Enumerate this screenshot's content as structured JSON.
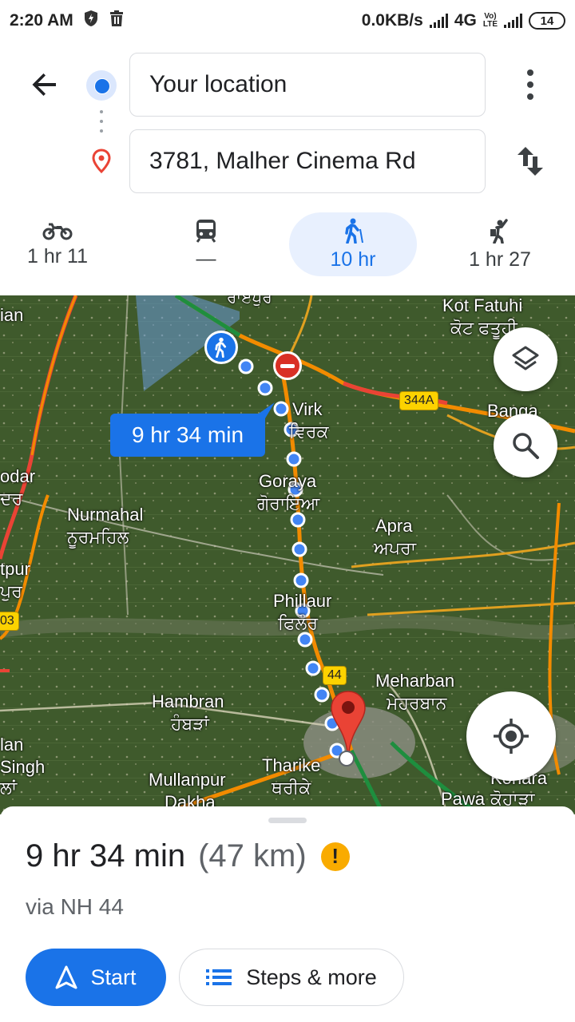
{
  "status_bar": {
    "time": "2:20 AM",
    "network_speed": "0.0KB/s",
    "network_type": "4G",
    "volte_line1": "Vo)",
    "volte_line2": "LTE",
    "battery": "14"
  },
  "directions": {
    "origin_value": "Your location",
    "destination_value": "3781, Malher Cinema Rd"
  },
  "travel_modes": [
    {
      "icon": "motorcycle-icon",
      "value": "1 hr 11",
      "selected": false
    },
    {
      "icon": "transit-icon",
      "value": "—",
      "selected": false
    },
    {
      "icon": "walk-icon",
      "value": "10 hr",
      "selected": true
    },
    {
      "icon": "hiking-icon",
      "value": "1 hr 27",
      "selected": false
    }
  ],
  "map": {
    "route_callout": "9 hr 34 min",
    "shields": [
      "344A",
      "44",
      "03"
    ],
    "places": [
      {
        "name": "Kot Fatuhi",
        "local": "ਕੋਟ ਫਤੂਹੀ"
      },
      {
        "name": "Virk",
        "local": "ਵਿਰਕ"
      },
      {
        "name": "Banga"
      },
      {
        "name": "Goraya",
        "local": "ਗੋਰਾਇਆ"
      },
      {
        "name": "Nurmahal",
        "local": "ਨੂਰਮਹਿਲ"
      },
      {
        "name": "Apra",
        "local": "ਅਪਰਾ"
      },
      {
        "name": "Phillaur",
        "local": "ਫਿਲੌਰ"
      },
      {
        "name": "Meharban",
        "local": "ਮੇਹਰਬਾਨ"
      },
      {
        "name": "Hambran",
        "local": "ਹੰਬੜਾਂ"
      },
      {
        "name": "Tharike",
        "local": "ਥਰੀਕੇ"
      },
      {
        "name": "Mullanpur",
        "local": "Dakha"
      },
      {
        "name": "Pawa",
        "local": "ਕੋਹਾੜਾ"
      },
      {
        "name": "Kohara"
      },
      {
        "name": "ian"
      },
      {
        "name": "odar",
        "local": "ਦਰ"
      },
      {
        "name": "tpur",
        "local": "ਪੁਰ"
      },
      {
        "name": "lan"
      },
      {
        "name": "Singh",
        "local": "ਲਾਂ"
      },
      {
        "name": "ਰਾਏਪੁਰ"
      }
    ]
  },
  "summary": {
    "duration": "9 hr 34 min",
    "distance": "(47 km)",
    "warning": "!",
    "via": "via NH 44"
  },
  "actions": {
    "start_label": "Start",
    "steps_label": "Steps & more"
  },
  "colors": {
    "accent": "#1a73e8",
    "warning": "#f9ab00",
    "destination_pin": "#ea4335",
    "traffic_orange": "#f28b00",
    "traffic_green": "#1e8e3e"
  }
}
